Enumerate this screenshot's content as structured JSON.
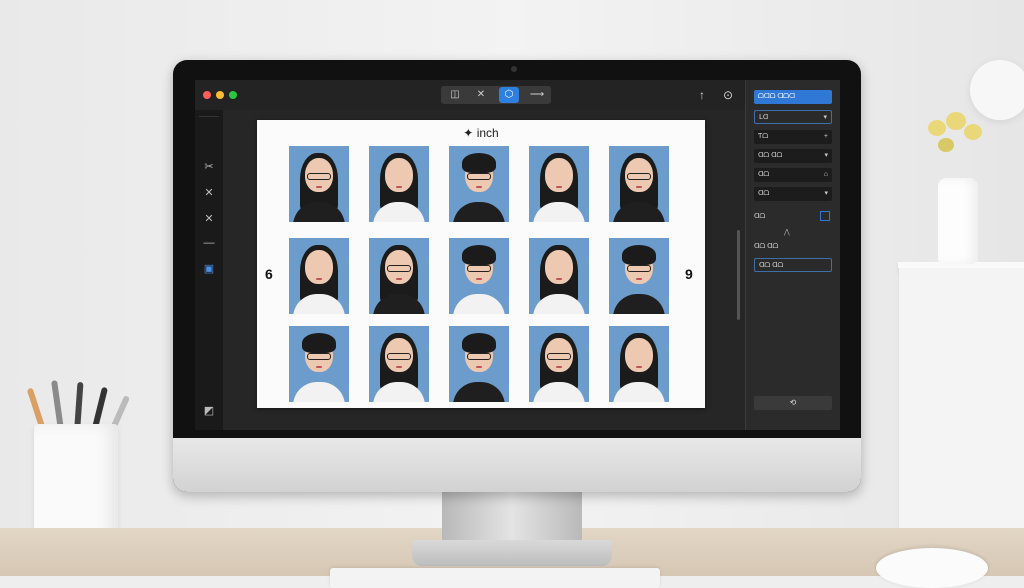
{
  "app": {
    "toolbar": {
      "tools": [
        "◫",
        "✕",
        "⬡",
        "⟶"
      ],
      "active_tool_index": 2,
      "share_icon": "↑",
      "account_icon": "⊙"
    },
    "left_tools": [
      "✂",
      "✕",
      "✕",
      "—",
      "▣"
    ],
    "bottom_left_icon": "◩",
    "sheet": {
      "title_icon": "✦",
      "title": "inch",
      "left_number": "6",
      "right_number": "9"
    },
    "right_panel": {
      "primary_row": "ᗝᗡᗝ ᗡᗝᗡ",
      "rows": [
        "ᒪᗡ",
        "Ƭᗝ",
        "ᗡᗝ ᗡᗝ",
        "ᗡᗝ",
        "ᗡᗝ"
      ],
      "row_icons": [
        "▾",
        "+",
        "▾",
        "⌂",
        "▾"
      ],
      "checkbox_label": "ᗡᗝ",
      "mini_icon": "⋀",
      "text_label": "ᗡᗝ ᗡᗝ",
      "field_value": "ᗡᗝ ᗡᗝ",
      "footer_button": "⟲"
    }
  },
  "colors": {
    "accent": "#2f78d6",
    "photo_background": "#6c9ccb",
    "close": "#ff5f57",
    "minimize": "#febc2e",
    "zoom": "#28c840"
  }
}
